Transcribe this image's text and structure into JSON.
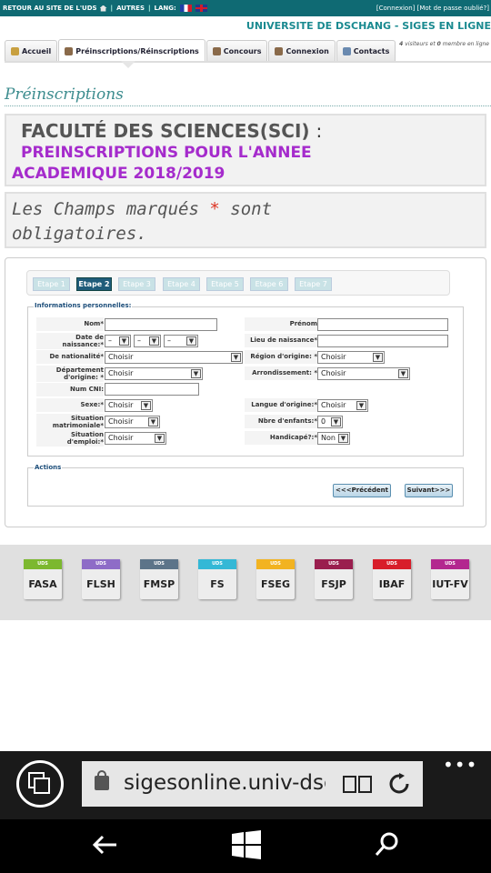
{
  "topbar": {
    "back_link": "RETOUR AU SITE DE L'UDS",
    "others": "AUTRES",
    "lang": "LANG:",
    "login": "[Connexion]",
    "forgot": "[Mot de passe oublié?]"
  },
  "site": {
    "title": "UNIVERSITE DE DSCHANG - SIGES EN LIGNE",
    "visitors_count": "4",
    "visitors_text": "visiteurs et",
    "members_count": "0",
    "members_text": "membre en ligne"
  },
  "tabs": [
    {
      "label": "Accueil",
      "icon": "home-icon",
      "color": "#c8a040"
    },
    {
      "label": "Préinscriptions/Réinscriptions",
      "icon": "users-icon",
      "color": "#8a6a4a"
    },
    {
      "label": "Concours",
      "icon": "users-icon",
      "color": "#8a6a4a"
    },
    {
      "label": "Connexion",
      "icon": "users-icon",
      "color": "#8a6a4a"
    },
    {
      "label": "Contacts",
      "icon": "contact-icon",
      "color": "#6a8ab0"
    }
  ],
  "section_title": "Préinscriptions",
  "faculty": {
    "name": "FACULTÉ DES SCIENCES(SCI)",
    "colon": ":",
    "year_line1": "PREINSCRIPTIONS POUR L'ANNEE",
    "year_line2": "ACADEMIQUE 2018/2019"
  },
  "notice": {
    "part1": "Les Champs marqués",
    "star": "*",
    "part2": "sont",
    "part3": "obligatoires."
  },
  "steps": [
    "Etape 1",
    "Etape 2",
    "Etape 3",
    "Etape 4",
    "Etape 5",
    "Etape 6",
    "Etape 7"
  ],
  "form": {
    "legend": "Informations personnelles:",
    "nom": "Nom*",
    "prenom": "Prénom",
    "date_naissance_1": "Date de",
    "date_naissance_2": "naissance:*",
    "lieu_naissance": "Lieu de naissance*",
    "nationalite": "De nationalité*",
    "region_origine": "Région d'origine: *",
    "departement_1": "Département",
    "departement_2": "d'origine: *",
    "arrondissement": "Arrondissement: *",
    "num_cni": "Num CNI:",
    "sexe": "Sexe:*",
    "langue_origine": "Langue d'origine:*",
    "situation_mat_1": "Situation",
    "situation_mat_2": "matrimoniale*",
    "nbre_enfants": "Nbre d'enfants:*",
    "situation_emp_1": "Situation",
    "situation_emp_2": "d'emploi:*",
    "handicape": "Handicapé?:*",
    "dash": "–",
    "choisir": "Choisir",
    "zero": "0",
    "non": "Non"
  },
  "actions": {
    "legend": "Actions",
    "prev": "<<<Précédent",
    "next": "Suivant>>>"
  },
  "faculties": [
    {
      "abbr": "FASA",
      "strip": "UDS",
      "color": "#7cb82f"
    },
    {
      "abbr": "FLSH",
      "strip": "UDS",
      "color": "#8e6cc7"
    },
    {
      "abbr": "FMSP",
      "strip": "UDS",
      "color": "#5c7489"
    },
    {
      "abbr": "FS",
      "strip": "UDS",
      "color": "#34b8d6"
    },
    {
      "abbr": "FSEG",
      "strip": "UDS",
      "color": "#f2b321"
    },
    {
      "abbr": "FSJP",
      "strip": "UDS",
      "color": "#9a1e4e"
    },
    {
      "abbr": "IBAF",
      "strip": "UDS",
      "color": "#d81e2a"
    },
    {
      "abbr": "IUT-FV",
      "strip": "UDS",
      "color": "#b3278f"
    }
  ],
  "browser": {
    "url": "sigesonline.univ-dschang.org",
    "more": "•••"
  }
}
